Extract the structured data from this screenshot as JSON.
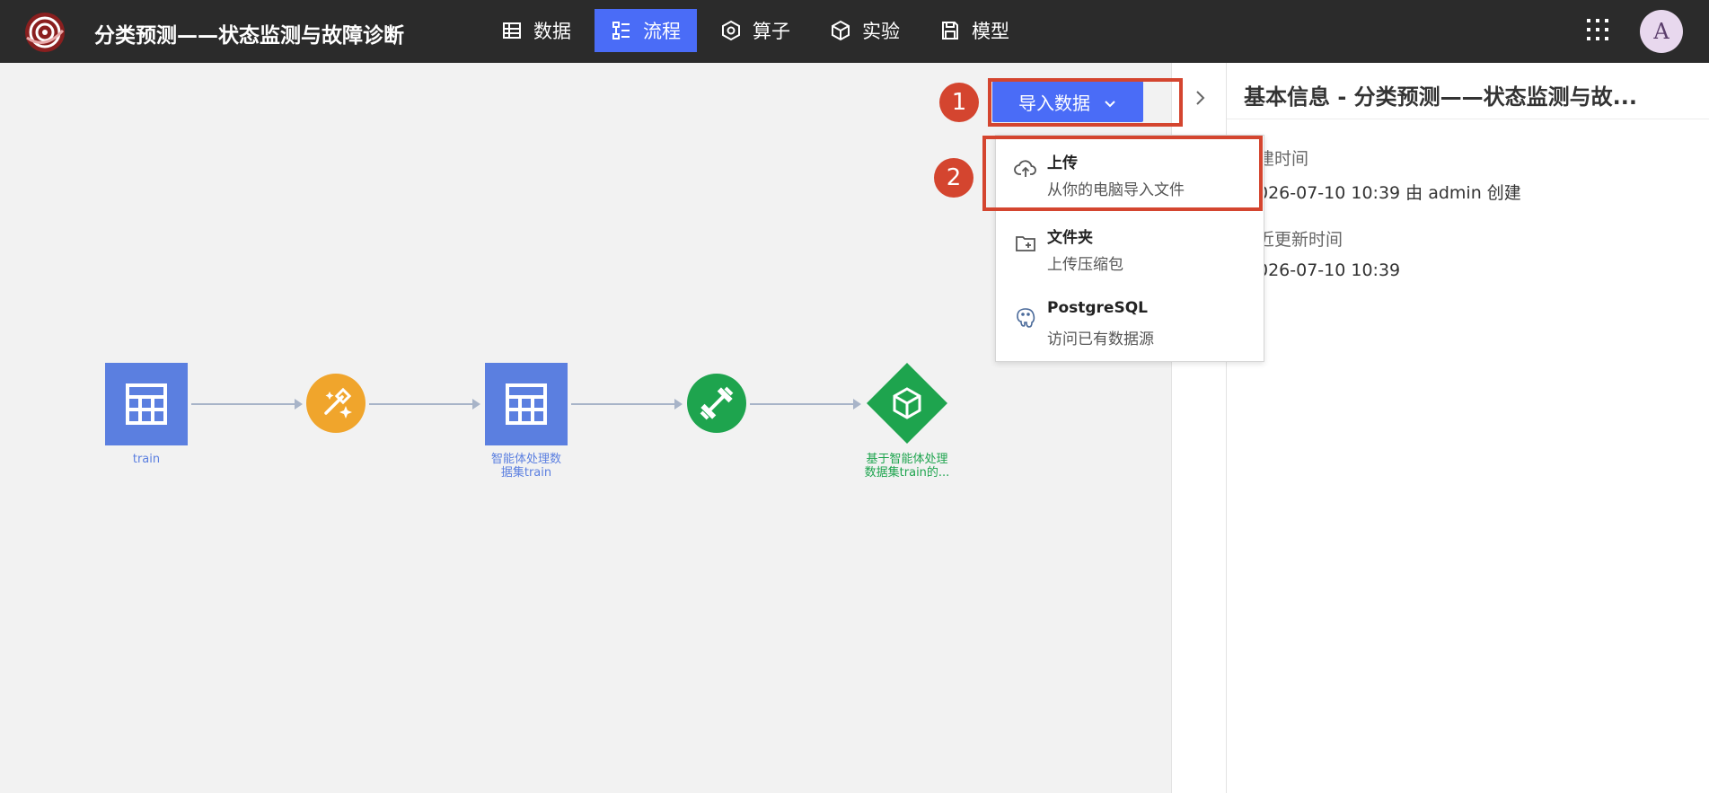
{
  "header": {
    "title": "分类预测——状态监测与故障诊断",
    "nav": [
      {
        "label": "数据",
        "icon": "table-icon"
      },
      {
        "label": "流程",
        "icon": "flow-icon",
        "active": true
      },
      {
        "label": "算子",
        "icon": "operator-icon"
      },
      {
        "label": "实验",
        "icon": "cube-icon"
      },
      {
        "label": "模型",
        "icon": "save-icon"
      }
    ],
    "avatar_letter": "A"
  },
  "flow": {
    "nodes": [
      {
        "label": "train",
        "type": "dataset",
        "color": "#5b7fe0"
      },
      {
        "label": "",
        "type": "agent-process",
        "color": "#f0a52c"
      },
      {
        "label": "智能体处理数据集train",
        "type": "dataset",
        "color": "#5b7fe0"
      },
      {
        "label": "",
        "type": "train",
        "color": "#1ea44e"
      },
      {
        "label": "基于智能体处理数据集train的...",
        "type": "model",
        "color": "#1ea44e"
      }
    ]
  },
  "import": {
    "button_label": "导入数据",
    "step1": "1",
    "step2": "2",
    "menu": [
      {
        "title": "上传",
        "subtitle": "从你的电脑导入文件",
        "icon": "upload-cloud-icon"
      },
      {
        "title": "文件夹",
        "subtitle": "上传压缩包",
        "icon": "folder-plus-icon"
      },
      {
        "title": "PostgreSQL",
        "subtitle": "访问已有数据源",
        "icon": "postgresql-icon"
      }
    ]
  },
  "panel": {
    "title": "基本信息 - 分类预测——状态监测与故...",
    "created_label": "建时间",
    "created_value": "026-07-10 10:39  由 admin 创建",
    "updated_label": "近更新时间",
    "updated_value": "026-07-10 10:39"
  },
  "colors": {
    "accent": "#4a6cf7",
    "highlight": "#d4452f",
    "topbar": "#2b2b2b"
  }
}
